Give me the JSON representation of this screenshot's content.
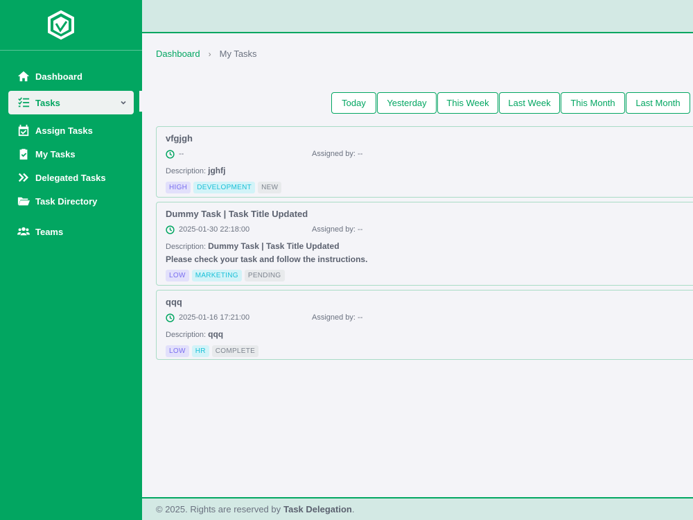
{
  "sidebar": {
    "items": [
      {
        "label": "Dashboard",
        "icon": "home-icon"
      },
      {
        "label": "Tasks",
        "icon": "task-list-icon"
      },
      {
        "label": "Assign Tasks",
        "icon": "calendar-check-icon"
      },
      {
        "label": "My Tasks",
        "icon": "clipboard-check-icon"
      },
      {
        "label": "Delegated Tasks",
        "icon": "double-chevron-right-icon"
      },
      {
        "label": "Task Directory",
        "icon": "folder-open-icon"
      },
      {
        "label": "Teams",
        "icon": "users-icon"
      }
    ]
  },
  "breadcrumb": {
    "root": "Dashboard",
    "separator": "›",
    "current": "My Tasks"
  },
  "filters": [
    "Today",
    "Yesterday",
    "This Week",
    "Last Week",
    "This Month",
    "Last Month"
  ],
  "tasks": [
    {
      "title": "vfgjgh",
      "date": "--",
      "assigned_by_label": "Assigned by:",
      "assigned_by": "--",
      "description_label": "Description:",
      "description": "jghfj",
      "description_extra": "",
      "priority": "HIGH",
      "category": "DEVELOPMENT",
      "status": "NEW"
    },
    {
      "title": "Dummy Task | Task Title Updated",
      "date": "2025-01-30 22:18:00",
      "assigned_by_label": "Assigned by:",
      "assigned_by": "--",
      "description_label": "Description:",
      "description": "Dummy Task | Task Title Updated",
      "description_extra": "Please check your task and follow the instructions.",
      "priority": "LOW",
      "category": "MARKETING",
      "status": "PENDING"
    },
    {
      "title": "qqq",
      "date": "2025-01-16 17:21:00",
      "assigned_by_label": "Assigned by:",
      "assigned_by": "--",
      "description_label": "Description:",
      "description": "qqq",
      "description_extra": "",
      "priority": "LOW",
      "category": "HR",
      "status": "COMPLETE"
    }
  ],
  "footer": {
    "text": "© 2025. Rights are reserved by",
    "brand": "Task Delegation",
    "suffix": "."
  },
  "colors": {
    "brand": "#02a661",
    "topbar": "#d3e9e4",
    "background": "#f4f4f8"
  }
}
